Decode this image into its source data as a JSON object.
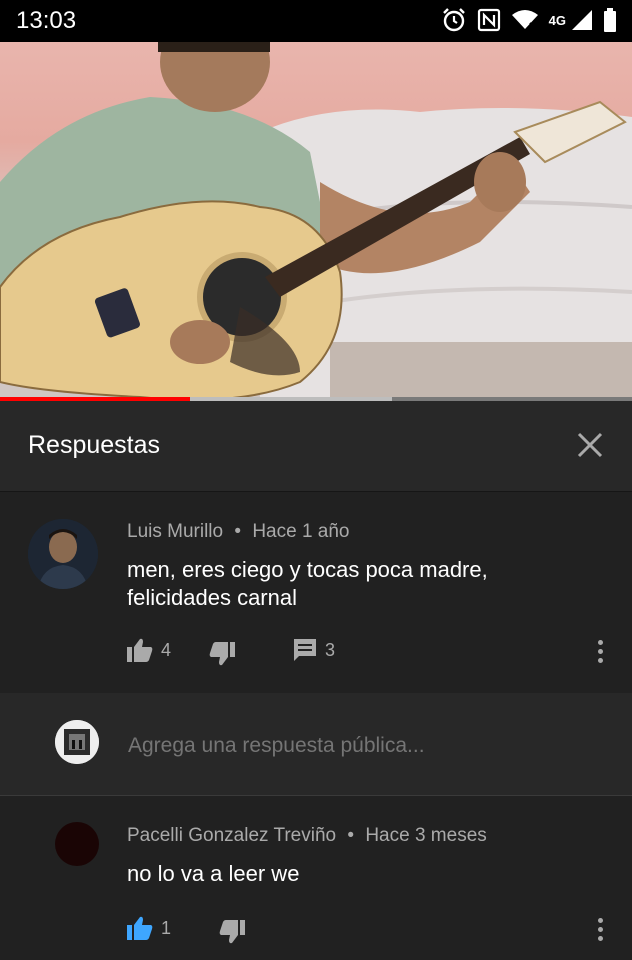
{
  "status_bar": {
    "time": "13:03",
    "network": "4G"
  },
  "panel": {
    "title": "Respuestas"
  },
  "main_comment": {
    "author": "Luis Murillo",
    "separator": "•",
    "time_ago": "Hace 1 año",
    "text_line1": "men, eres ciego y tocas poca madre,",
    "text_line2": "felicidades carnal",
    "likes": "4",
    "replies": "3"
  },
  "reply_box": {
    "placeholder": "Agrega una respuesta pública..."
  },
  "reply_comment": {
    "author": "Pacelli Gonzalez Treviño",
    "separator": "•",
    "time_ago": "Hace 3 meses",
    "text": "no lo va a leer we",
    "likes": "1"
  },
  "video": {
    "progress_fraction": 0.3,
    "buffered_fraction": 0.62
  },
  "colors": {
    "background": "#212121",
    "header_bg": "#282828",
    "secondary_text": "#aaaaaa",
    "accent_red": "#ff0000",
    "liked_blue": "#3ea6ff"
  },
  "icons": [
    "alarm-icon",
    "nfc-icon",
    "wifi-icon",
    "signal-icon",
    "battery-icon",
    "close-icon",
    "thumbs-up-icon",
    "thumbs-down-icon",
    "reply-icon",
    "more-vert-icon"
  ]
}
